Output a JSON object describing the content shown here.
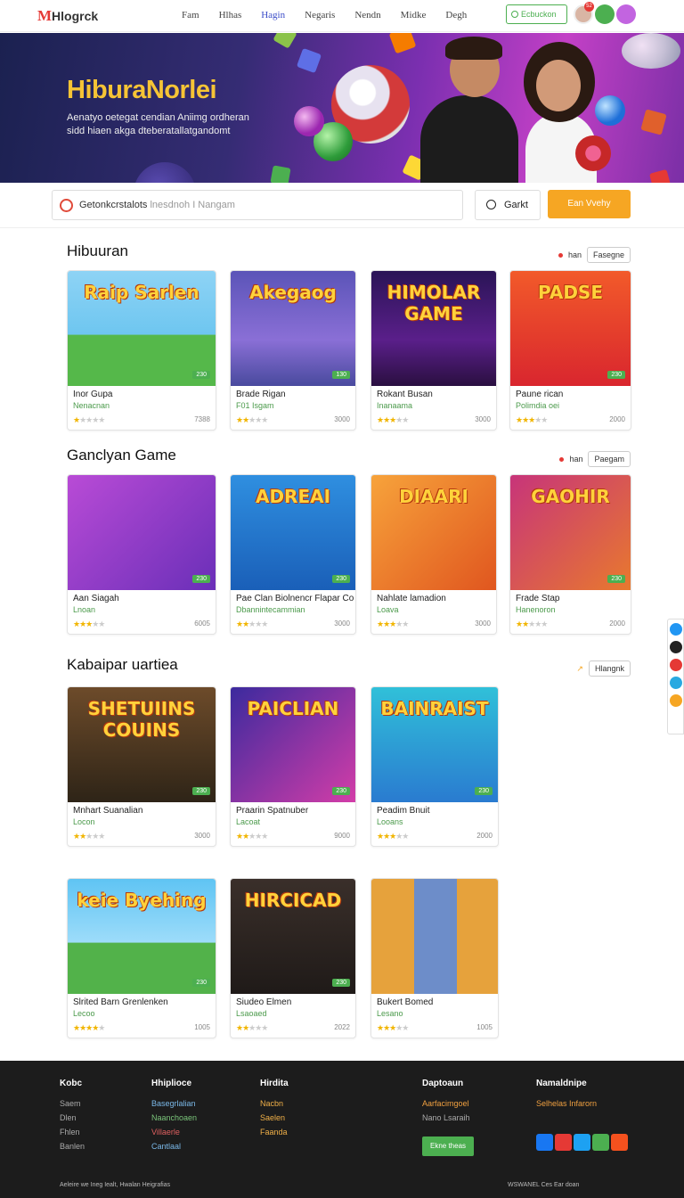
{
  "nav": {
    "logo_m": "M",
    "logo_rest": "Hlogrck",
    "menu": [
      "Fam",
      "Hlhas",
      "Hagin",
      "Negaris",
      "Nendn",
      "Midke",
      "Degh"
    ],
    "search_label": "Ecbuckon",
    "badge": "52"
  },
  "hero": {
    "title": "HiburaNorlei",
    "desc": "Aenatyo oetegat cendian Aniimg ordheran sidd hiaen akga dteberatallatgandomt"
  },
  "search": {
    "text": "Getonkcrstalots",
    "placeholder": "lnesdnoh I Nangam",
    "button": "Garkt",
    "cta": "Ean Vvehy"
  },
  "sections": [
    {
      "title": "Hibuuran",
      "ctrl_text": "han",
      "ctrl_btn": "Fasegne",
      "cards": [
        {
          "thumb_text": "Raip Sarlen",
          "tag": "230",
          "title": "Inor Gupa",
          "sub": "Nenacnan",
          "rating": 1,
          "num": "7388"
        },
        {
          "thumb_text": "Akegaog",
          "tag": "130",
          "title": "Brade Rigan",
          "sub": "F01 Isgam",
          "rating": 2,
          "num": "3000"
        },
        {
          "thumb_text": "HIMOLAR GAME",
          "tag": "",
          "title": "Rokant Busan",
          "sub": "Inanaama",
          "rating": 3,
          "num": "3000"
        },
        {
          "thumb_text": "PADSE",
          "tag": "230",
          "title": "Paune rican",
          "sub": "Polimdia oei",
          "rating": 3,
          "num": "2000"
        }
      ]
    },
    {
      "title": "Ganclyan Game",
      "ctrl_text": "han",
      "ctrl_btn": "Paegam",
      "cards": [
        {
          "thumb_text": "",
          "tag": "230",
          "title": "Aan Siagah",
          "sub": "Lnoan",
          "rating": 3,
          "num": "6005"
        },
        {
          "thumb_text": "ADREAI",
          "tag": "230",
          "title": "Pae Clan Biolnencr Flapar Co",
          "sub": "Dbannintecammian",
          "rating": 2,
          "num": "3000"
        },
        {
          "thumb_text": "DIAARI",
          "tag": "",
          "title": "Nahlate lamadion",
          "sub": "Loava",
          "rating": 3,
          "num": "3000"
        },
        {
          "thumb_text": "GAOHIR",
          "tag": "230",
          "title": "Frade Stap",
          "sub": "Hanenoron",
          "rating": 2,
          "num": "2000"
        }
      ]
    },
    {
      "title": "Kabaipar uartiea",
      "ctrl_text": "",
      "ctrl_btn": "Hlangnk",
      "cards": [
        {
          "thumb_text": "SHETUIINS COUINS",
          "tag": "230",
          "title": "Mnhart Suanalian",
          "sub": "Locon",
          "rating": 2,
          "num": "3000"
        },
        {
          "thumb_text": "PAICLIAN",
          "tag": "230",
          "title": "Praarin Spatnuber",
          "sub": "Lacoat",
          "rating": 2,
          "num": "9000"
        },
        {
          "thumb_text": "BAINRAIST",
          "tag": "230",
          "title": "Peadim Bnuit",
          "sub": "Looans",
          "rating": 3,
          "num": "2000"
        }
      ]
    },
    {
      "title": "",
      "ctrl_text": "",
      "ctrl_btn": "",
      "cards": [
        {
          "thumb_text": "keie Byehing",
          "tag": "230",
          "title": "Slrited Barn Grenlenken",
          "sub": "Lecoo",
          "rating": 4,
          "num": "1005"
        },
        {
          "thumb_text": "HIRCICAD",
          "tag": "230",
          "title": "Siudeo Elmen",
          "sub": "Lsaoaed",
          "rating": 2,
          "num": "2022"
        },
        {
          "thumb_text": "",
          "tag": "",
          "title": "Bukert Bomed",
          "sub": "Lesano",
          "rating": 3,
          "num": "1005"
        }
      ]
    }
  ],
  "footer": {
    "cols": [
      {
        "head": "Kobc",
        "links": [
          "Saem",
          "Dlen",
          "Fhlen",
          "Banlen"
        ]
      },
      {
        "head": "Hhiplioce",
        "links": [
          "Basegrlalian",
          "Naanchoaen",
          "Villaerle",
          "Cantlaal"
        ]
      },
      {
        "head": "Hirdita",
        "links": [
          "Nacbn",
          "Saelen",
          "Faanda"
        ]
      },
      {
        "head": "Daptoaun",
        "links": [
          "Aarfacimgoel",
          "Nano Lsaraih"
        ]
      },
      {
        "head": "Namaldnipe",
        "links": [
          "Selhelas Infarorn"
        ]
      }
    ],
    "cta": "Ekne theas",
    "copyright": "Aeleire we Ineg Iealt, Hwalan Heigrafias",
    "right": "WSWANEL  Ces  Ear doan"
  },
  "colors": {
    "accent": "#f6a623",
    "green": "#4caf50",
    "link": "#3a4cc8",
    "footer_bg": "#1c1c1c"
  }
}
